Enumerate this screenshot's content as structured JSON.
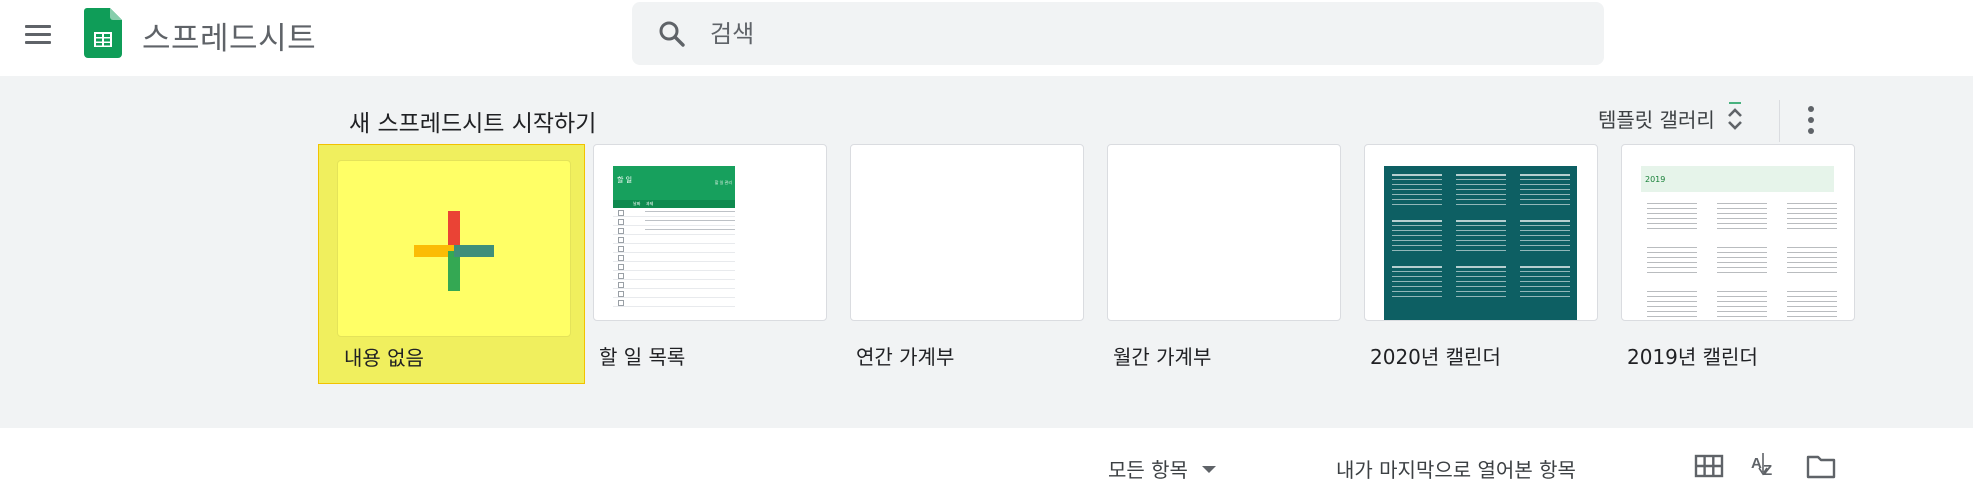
{
  "header": {
    "app_title": "스프레드시트",
    "search_placeholder": "검색"
  },
  "gallery": {
    "title": "새 스프레드시트 시작하기",
    "toggle_label": "템플릿 갤러리",
    "templates": [
      {
        "label": "내용 없음",
        "selected": true
      },
      {
        "label": "할 일 목록"
      },
      {
        "label": "연간 가계부"
      },
      {
        "label": "월간 가계부"
      },
      {
        "label": "2020년 캘린더"
      },
      {
        "label": "2019년 캘린더"
      }
    ],
    "todo_thumb": {
      "header_text": "할 일",
      "right_header_text": "할 일 관리",
      "col_headers": [
        "날짜",
        "과제"
      ]
    },
    "cal2019_thumb": {
      "year": "2019"
    }
  },
  "footer": {
    "owner_filter": "모든 항목",
    "sort_label": "내가 마지막으로 열어본 항목"
  },
  "colors": {
    "accent_yellow": "#ffff66",
    "sheets_green": "#0f9d58",
    "calendar_teal": "#0d5f63"
  }
}
